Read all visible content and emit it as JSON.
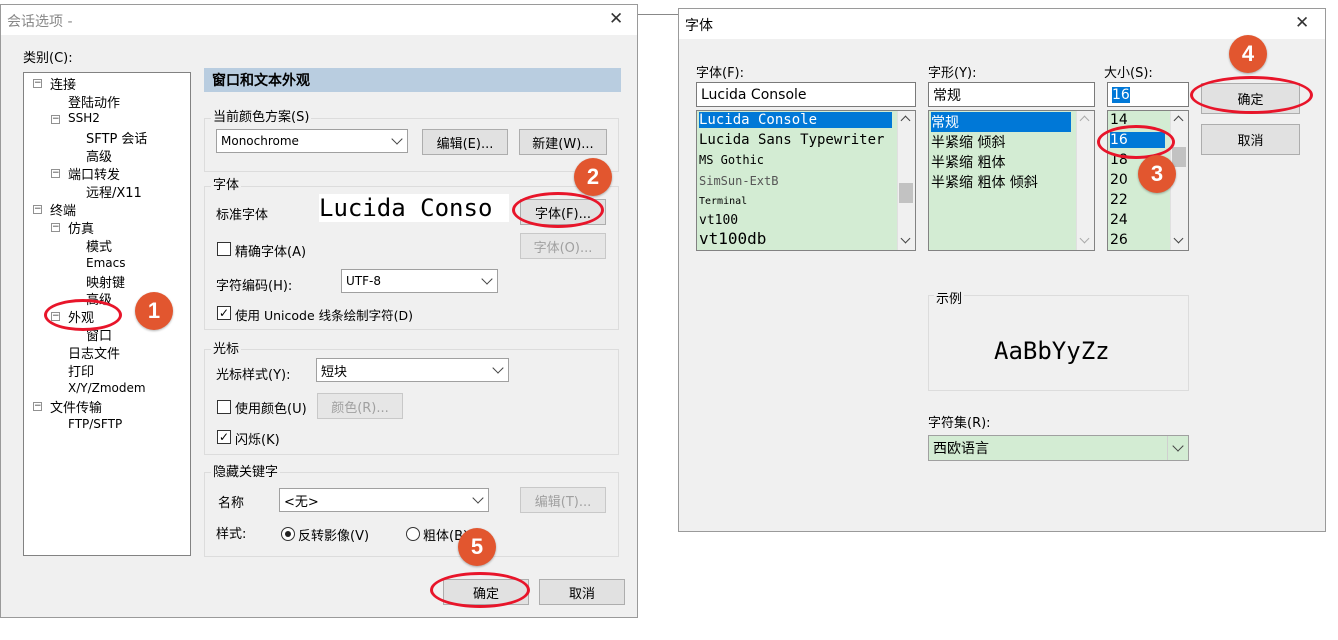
{
  "session_dialog": {
    "title": "会话选项 -",
    "category_label": "类别(C):",
    "tree": [
      {
        "label": "连接",
        "expander": "−"
      },
      {
        "label": "登陆动作"
      },
      {
        "label": "SSH2",
        "expander": "−"
      },
      {
        "label": "SFTP 会话"
      },
      {
        "label": "高级"
      },
      {
        "label": "端口转发",
        "expander": "−"
      },
      {
        "label": "远程/X11"
      },
      {
        "label": "终端",
        "expander": "−"
      },
      {
        "label": "仿真",
        "expander": "−"
      },
      {
        "label": "模式"
      },
      {
        "label": "Emacs"
      },
      {
        "label": "映射键"
      },
      {
        "label": "高级"
      },
      {
        "label": "外观",
        "expander": "−"
      },
      {
        "label": "窗口"
      },
      {
        "label": "日志文件"
      },
      {
        "label": "打印"
      },
      {
        "label": "X/Y/Zmodem"
      },
      {
        "label": "文件传输",
        "expander": "−"
      },
      {
        "label": "FTP/SFTP"
      }
    ],
    "section_title": "窗口和文本外观",
    "color_scheme": {
      "label": "当前颜色方案(S)",
      "value": "Monochrome",
      "edit": "编辑(E)...",
      "new": "新建(W)..."
    },
    "font_group": {
      "label": "字体",
      "standard_font_label": "标准字体",
      "standard_font_preview": "Lucida Conso",
      "font_button": "字体(F)...",
      "precise_font_label": "精确字体(A)",
      "precise_font_button": "字体(O)...",
      "encoding_label": "字符编码(H):",
      "encoding_value": "UTF-8",
      "unicode_label": "使用 Unicode 线条绘制字符(D)"
    },
    "cursor_group": {
      "label": "光标",
      "style_label": "光标样式(Y):",
      "style_value": "短块",
      "use_color_label": "使用颜色(U)",
      "color_button": "颜色(R)...",
      "blink_label": "闪烁(K)"
    },
    "keyword_group": {
      "label": "隐藏关键字",
      "name_label": "名称",
      "name_value": "<无>",
      "edit_button": "编辑(T)...",
      "style_label": "样式:",
      "style_reverse": "反转影像(V)",
      "style_bold": "粗体(B)"
    },
    "ok": "确定",
    "cancel": "取消"
  },
  "font_dialog": {
    "title": "字体",
    "font_label": "字体(F):",
    "font_value": "Lucida Console",
    "fonts": [
      "Lucida Console",
      "Lucida Sans Typewriter",
      "MS Gothic",
      "SimSun-ExtB",
      "Terminal",
      "vt100",
      "vt100db"
    ],
    "style_label": "字形(Y):",
    "style_value": "常规",
    "styles": [
      "常规",
      "半紧缩 倾斜",
      "半紧缩 粗体",
      "半紧缩 粗体 倾斜"
    ],
    "size_label": "大小(S):",
    "size_value": "16",
    "sizes": [
      "14",
      "16",
      "18",
      "20",
      "22",
      "24",
      "26"
    ],
    "ok": "确定",
    "cancel": "取消",
    "sample_label": "示例",
    "sample_text": "AaBbYyZz",
    "charset_label": "字符集(R):",
    "charset_value": "西欧语言"
  },
  "annotations": [
    "1",
    "2",
    "3",
    "4",
    "5"
  ],
  "colors": {
    "annotation": "#e2562f",
    "highlight_ring": "#e8152a",
    "selection": "#0078d7",
    "list_bg": "#d3ecd3",
    "banner": "#b9cde0"
  }
}
